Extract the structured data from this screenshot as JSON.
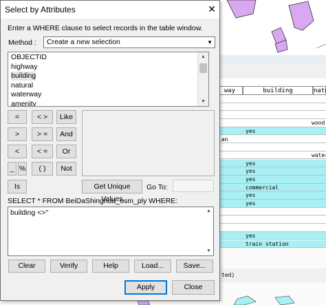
{
  "dialog": {
    "title": "Select by Attributes",
    "close_glyph": "✕",
    "instruction": "Enter a WHERE clause to select records in the table window.",
    "method_label": "Method :",
    "method_value": "Create a new selection",
    "fields": [
      "OBJECTID",
      "highway",
      "building",
      "natural",
      "waterway",
      "amenity"
    ],
    "selected_field": "building",
    "operators": {
      "eq": "=",
      "ne": "< >",
      "like": "Like",
      "gt": ">",
      "ge": "> =",
      "and": "And",
      "lt": "<",
      "le": "< =",
      "or": "Or",
      "underscore": "_",
      "percent": "%",
      "parens": "( )",
      "not": "Not",
      "is": "Is"
    },
    "get_unique_values": "Get Unique Values",
    "goto_label": "Go To:",
    "select_from": "SELECT * FROM BeiDaShinghua_osm_ply WHERE:",
    "expression": "building <>''",
    "buttons": {
      "clear": "Clear",
      "verify": "Verify",
      "help": "Help",
      "load": "Load...",
      "save": "Save...",
      "apply": "Apply",
      "close": "Close"
    }
  },
  "background_table": {
    "headers": [
      "way",
      "building",
      "natu"
    ],
    "rows": [
      [
        "",
        "",
        ""
      ],
      [
        "",
        "",
        ""
      ],
      [
        "",
        "",
        ""
      ],
      [
        "",
        "",
        "wood"
      ],
      [
        "",
        "yes",
        ""
      ],
      [
        "ian",
        "",
        ""
      ],
      [
        "",
        "",
        ""
      ],
      [
        "",
        "",
        "water"
      ],
      [
        "",
        "yes",
        ""
      ],
      [
        "",
        "yes",
        ""
      ],
      [
        "",
        "yes",
        ""
      ],
      [
        "",
        "commercial",
        ""
      ],
      [
        "",
        "yes",
        ""
      ],
      [
        "",
        "yes",
        ""
      ],
      [
        "",
        "",
        ""
      ],
      [
        "",
        "",
        ""
      ],
      [
        "",
        "",
        ""
      ],
      [
        "",
        "yes",
        ""
      ],
      [
        "",
        "train station",
        ""
      ]
    ],
    "row_colors": [
      "#ffffff",
      "#ffffff",
      "#ffffff",
      "#ffffff",
      "#a8f0f4",
      "#ffffff",
      "#ffffff",
      "#ffffff",
      "#a8f0f4",
      "#a8f0f4",
      "#a8f0f4",
      "#a8f0f4",
      "#a8f0f4",
      "#a8f0f4",
      "#ffffff",
      "#ffffff",
      "#ffffff",
      "#a8f0f4",
      "#a8f0f4"
    ],
    "footer": "ted)"
  },
  "colors": {
    "map_polygon": "#d8a8f0",
    "selected_row": "#a8f0f4",
    "accent": "#0078d7"
  }
}
